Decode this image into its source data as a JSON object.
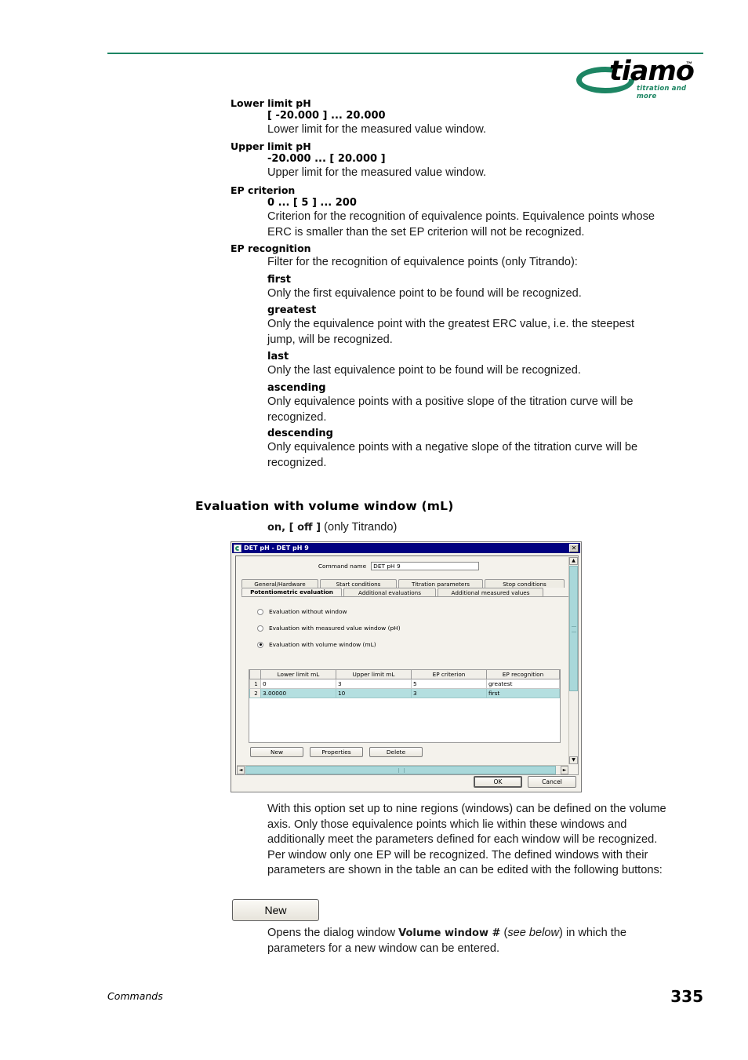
{
  "header": {
    "logo_word": "tiamo",
    "logo_tm": "™",
    "logo_tagline": "titration and more"
  },
  "entries": [
    {
      "term": "Lower limit pH",
      "range": "[ -20.000 ] ... 20.000",
      "description": "Lower limit for the measured value window."
    },
    {
      "term": "Upper limit pH",
      "range": "-20.000 ... [ 20.000 ]",
      "description": "Upper limit for the measured value window."
    },
    {
      "term": "EP criterion",
      "range": "0 ... [ 5 ] ... 200",
      "description": "Criterion for the recognition of equivalence points. Equivalence points whose ERC is smaller than the set EP criterion will not be recognized."
    },
    {
      "term": "EP recognition",
      "description": "Filter for the recognition of equivalence points (only Titrando):"
    }
  ],
  "ep_recognition_options": [
    {
      "name": "first",
      "description": "Only the first equivalence point to be found will be recognized."
    },
    {
      "name": "greatest",
      "description": "Only the equivalence point with the greatest ERC value, i.e. the steepest jump, will be recognized."
    },
    {
      "name": "last",
      "description": "Only the last equivalence point to be found will be recognized."
    },
    {
      "name": "ascending",
      "description": "Only equivalence points with a positive slope of the titration curve will be recognized."
    },
    {
      "name": "descending",
      "description": "Only equivalence points with a negative slope of the titration curve will be recognized."
    }
  ],
  "section": {
    "heading": "Evaluation with volume window (mL)",
    "values_bold": "on, [ off ]",
    "values_rest": " (only Titrando)"
  },
  "dialog": {
    "title": "DET pH - DET pH 9",
    "close_label": "✕",
    "command_name_label": "Command name",
    "command_name_value": "DET pH 9",
    "tabs_row1": [
      "General/Hardware",
      "Start conditions",
      "Titration parameters",
      "Stop conditions"
    ],
    "tabs_row2": [
      "Potentiometric evaluation",
      "Additional evaluations",
      "Additional measured values"
    ],
    "active_tab": "Potentiometric evaluation",
    "radios": [
      {
        "label": "Evaluation without window",
        "checked": false
      },
      {
        "label": "Evaluation with measured value window (pH)",
        "checked": false
      },
      {
        "label": "Evaluation with volume window (mL)",
        "checked": true
      }
    ],
    "table": {
      "columns": [
        "Lower limit mL",
        "Upper limit mL",
        "EP criterion",
        "EP recognition"
      ],
      "rows": [
        {
          "index": "1",
          "cells": [
            "0",
            "3",
            "5",
            "greatest"
          ],
          "selected": false
        },
        {
          "index": "2",
          "cells": [
            "3.00000",
            "10",
            "3",
            "first"
          ],
          "selected": true
        }
      ]
    },
    "table_buttons": [
      "New",
      "Properties",
      "Delete"
    ],
    "footer_buttons": [
      "OK",
      "Cancel"
    ],
    "scroll_arrows": {
      "up": "▲",
      "down": "▼",
      "left": "◄",
      "right": "►"
    }
  },
  "body_paragraph": "With this option set up to nine regions (windows) can be defined on the volume axis. Only those equivalence points which lie within these windows and additionally meet the parameters defined for each window will be recognized. Per window only one EP will be recognized. The defined windows with their parameters are shown in the table an can be edited with the following buttons:",
  "new_button": {
    "label": "New",
    "description_prefix": "Opens the dialog window ",
    "description_bold": "Volume window #",
    "description_mid": " (",
    "description_italic": "see below",
    "description_suffix": ") in which the parameters for a new window can be entered."
  },
  "footer": {
    "section_label": "Commands",
    "page_number": "335"
  },
  "colors": {
    "brand_green": "#1d8563",
    "titlebar_blue": "#000080",
    "selection_teal": "#b4dfe0",
    "scrollbar_teal": "#a9d8da"
  }
}
